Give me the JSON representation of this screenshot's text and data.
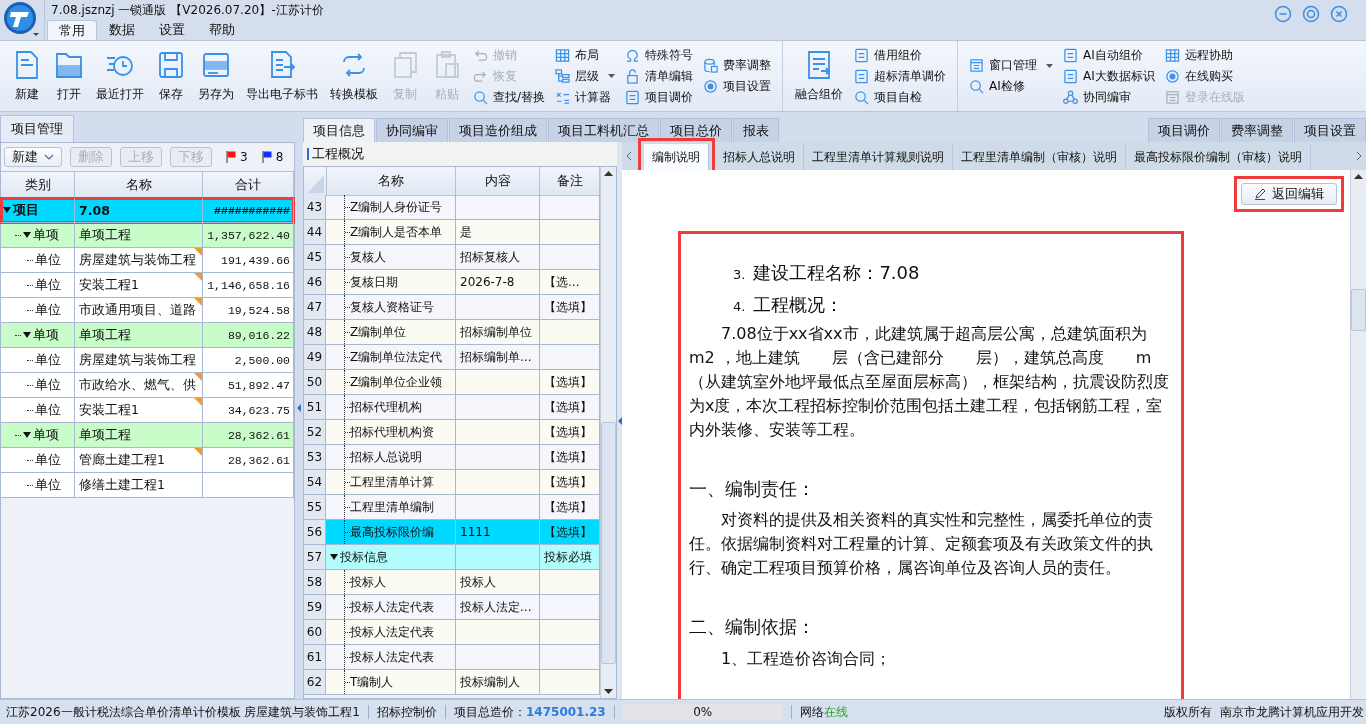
{
  "window": {
    "title": "7.08.jsznzj 一锁通版 【V2026.07.20】-江苏计价"
  },
  "menu_tabs": [
    {
      "label": "常用",
      "selected": true
    },
    {
      "label": "数据",
      "selected": false
    },
    {
      "label": "设置",
      "selected": false
    },
    {
      "label": "帮助",
      "selected": false
    }
  ],
  "toolbar": {
    "sections": [
      {
        "large": [
          {
            "label": "新建",
            "disabled": false
          },
          {
            "label": "打开",
            "disabled": false
          },
          {
            "label": "最近打开",
            "disabled": false
          },
          {
            "label": "保存",
            "disabled": false
          },
          {
            "label": "另存为",
            "disabled": false
          },
          {
            "label": "导出电子标书",
            "disabled": false
          },
          {
            "label": "转换模板",
            "disabled": false
          },
          {
            "label": "复制",
            "disabled": true
          },
          {
            "label": "粘贴",
            "disabled": true
          }
        ],
        "columns": [
          [
            {
              "label": "撤销",
              "disabled": true,
              "dropdown": false
            },
            {
              "label": "恢复",
              "disabled": true,
              "dropdown": false
            },
            {
              "label": "查找/替换",
              "disabled": false,
              "dropdown": false
            }
          ],
          [
            {
              "label": "布局",
              "disabled": false,
              "dropdown": false
            },
            {
              "label": "层级",
              "disabled": false,
              "dropdown": true
            },
            {
              "label": "计算器",
              "disabled": false,
              "dropdown": false
            }
          ],
          [
            {
              "label": "特殊符号",
              "disabled": false,
              "dropdown": false
            },
            {
              "label": "清单编辑",
              "disabled": false,
              "dropdown": false
            },
            {
              "label": "项目调价",
              "disabled": false,
              "dropdown": false
            }
          ],
          [
            {
              "label": "费率调整",
              "disabled": false,
              "dropdown": false
            },
            {
              "label": "项目设置",
              "disabled": false,
              "dropdown": false
            }
          ]
        ]
      },
      {
        "large": [
          {
            "label": "融合组价",
            "disabled": false
          }
        ],
        "columns": [
          [
            {
              "label": "借用组价",
              "disabled": false,
              "dropdown": false
            },
            {
              "label": "超标清单调价",
              "disabled": false,
              "dropdown": false
            },
            {
              "label": "项目自检",
              "disabled": false,
              "dropdown": false
            }
          ]
        ]
      },
      {
        "columns": [
          [
            {
              "label": "窗口管理",
              "disabled": false,
              "dropdown": true
            },
            {
              "label": "AI检修",
              "disabled": false,
              "dropdown": false
            }
          ],
          [
            {
              "label": "AI自动组价",
              "disabled": false,
              "dropdown": false
            },
            {
              "label": "AI大数据标识",
              "disabled": false,
              "dropdown": false
            },
            {
              "label": "协同编审",
              "disabled": false,
              "dropdown": false
            }
          ],
          [
            {
              "label": "远程协助",
              "disabled": false,
              "dropdown": false
            },
            {
              "label": "在线购买",
              "disabled": false,
              "dropdown": false
            },
            {
              "label": "登录在线版",
              "disabled": true,
              "dropdown": false
            }
          ]
        ]
      }
    ]
  },
  "project_panel": {
    "tab": "项目管理",
    "buttons": [
      {
        "label": "新建",
        "disabled": false,
        "dropdown": true
      },
      {
        "label": "删除",
        "disabled": true,
        "dropdown": false
      },
      {
        "label": "上移",
        "disabled": true,
        "dropdown": false
      },
      {
        "label": "下移",
        "disabled": true,
        "dropdown": false
      }
    ],
    "flags": [
      {
        "count": "3",
        "color": "#ff1010"
      },
      {
        "count": "8",
        "color": "#1030ff"
      }
    ],
    "columns": [
      "类别",
      "名称",
      "合计"
    ],
    "tree": [
      {
        "type": "项目",
        "name": "7.08",
        "total": "###########",
        "selected": true,
        "highlighted": true,
        "marked": false,
        "children": [
          {
            "type": "单项",
            "name": "单项工程",
            "total": "1,357,622.40",
            "selected": false,
            "highlighted": false,
            "marked": false,
            "children": [
              {
                "type": "单位",
                "name": "房屋建筑与装饰工程",
                "total": "191,439.66",
                "selected": false,
                "highlighted": false,
                "marked": true
              },
              {
                "type": "单位",
                "name": "安装工程1",
                "total": "1,146,658.16",
                "selected": false,
                "highlighted": false,
                "marked": true
              },
              {
                "type": "单位",
                "name": "市政通用项目、道路",
                "total": "19,524.58",
                "selected": false,
                "highlighted": false,
                "marked": true
              }
            ]
          },
          {
            "type": "单项",
            "name": "单项工程",
            "total": "89,016.22",
            "selected": false,
            "highlighted": false,
            "marked": false,
            "children": [
              {
                "type": "单位",
                "name": "房屋建筑与装饰工程",
                "total": "2,500.00",
                "selected": false,
                "highlighted": false,
                "marked": false
              },
              {
                "type": "单位",
                "name": "市政给水、燃气、供",
                "total": "51,892.47",
                "selected": false,
                "highlighted": false,
                "marked": true
              },
              {
                "type": "单位",
                "name": "安装工程1",
                "total": "34,623.75",
                "selected": false,
                "highlighted": false,
                "marked": true
              }
            ]
          },
          {
            "type": "单项",
            "name": "单项工程",
            "total": "28,362.61",
            "selected": false,
            "highlighted": false,
            "marked": false,
            "children": [
              {
                "type": "单位",
                "name": "管廊土建工程1",
                "total": "28,362.61",
                "selected": false,
                "highlighted": false,
                "marked": true
              },
              {
                "type": "单位",
                "name": "修缮土建工程1",
                "selected": false,
                "highlighted": false,
                "marked": false
              }
            ]
          }
        ]
      }
    ]
  },
  "center_tabs": [
    {
      "label": "项目信息",
      "selected": true
    },
    {
      "label": "协同编审",
      "selected": false
    },
    {
      "label": "项目造价组成",
      "selected": false
    },
    {
      "label": "项目工料机汇总",
      "selected": false
    },
    {
      "label": "项目总价",
      "selected": false
    },
    {
      "label": "报表",
      "selected": false
    }
  ],
  "quick_buttons": [
    "项目调价",
    "费率调整",
    "项目设置"
  ],
  "info": {
    "section_title": "工程概况",
    "columns": [
      "名称",
      "内容",
      "备注"
    ],
    "rows": [
      {
        "kind": "item",
        "number": "43",
        "name": "Z编制人身份证号",
        "selected": false
      },
      {
        "kind": "item",
        "number": "44",
        "name": "Z编制人是否本单",
        "content": "是",
        "selected": false
      },
      {
        "kind": "item",
        "number": "45",
        "name": "复核人",
        "content": "招标复核人",
        "selected": false
      },
      {
        "kind": "item",
        "number": "46",
        "name": "复核日期",
        "content": "2026-7-8",
        "note": "【选...",
        "selected": false
      },
      {
        "kind": "item",
        "number": "47",
        "name": "复核人资格证号",
        "note": "【选填】",
        "selected": false
      },
      {
        "kind": "item",
        "number": "48",
        "name": "Z编制单位",
        "content": "招标编制单位",
        "selected": false
      },
      {
        "kind": "item",
        "number": "49",
        "name": "Z编制单位法定代",
        "content": "招标编制单...",
        "selected": false
      },
      {
        "kind": "item",
        "number": "50",
        "name": "Z编制单位企业领",
        "note": "【选填】",
        "selected": false
      },
      {
        "kind": "item",
        "number": "51",
        "name": "招标代理机构",
        "note": "【选填】",
        "selected": false
      },
      {
        "kind": "item",
        "number": "52",
        "name": "招标代理机构资",
        "note": "【选填】",
        "selected": false
      },
      {
        "kind": "item",
        "number": "53",
        "name": "招标人总说明",
        "note": "【选填】",
        "selected": false
      },
      {
        "kind": "item",
        "number": "54",
        "name": "工程里清单计算",
        "note": "【选填】",
        "selected": false
      },
      {
        "kind": "item",
        "number": "55",
        "name": "工程里清单编制",
        "note": "【选填】",
        "selected": false
      },
      {
        "kind": "item",
        "number": "56",
        "name": "最高投标限价编",
        "content": "1111",
        "note": "【选填】",
        "selected": true
      },
      {
        "kind": "group",
        "number": "57",
        "name": "投标信息",
        "note": "投标必填",
        "selected": false
      },
      {
        "kind": "item",
        "number": "58",
        "name": "投标人",
        "content": "投标人",
        "selected": false
      },
      {
        "kind": "item",
        "number": "59",
        "name": "投标人法定代表",
        "content": "投标人法定...",
        "selected": false
      },
      {
        "kind": "item",
        "number": "60",
        "name": "投标人法定代表",
        "selected": false
      },
      {
        "kind": "item",
        "number": "61",
        "name": "投标人法定代表",
        "selected": false
      },
      {
        "kind": "item",
        "number": "62",
        "name": "T编制人",
        "content": "投标编制人",
        "selected": false
      }
    ]
  },
  "doc_tabs": [
    {
      "label": "编制说明",
      "selected": true,
      "highlighted": true
    },
    {
      "label": "招标人总说明",
      "selected": false,
      "highlighted": false
    },
    {
      "label": "工程里清单计算规则说明",
      "selected": false,
      "highlighted": false
    },
    {
      "label": "工程里清单编制（审核）说明",
      "selected": false,
      "highlighted": false
    },
    {
      "label": "最高投标限价编制（审核）说明",
      "selected": false,
      "highlighted": false
    }
  ],
  "return_button": {
    "label": "返回编辑",
    "highlighted": true
  },
  "document": {
    "highlighted": true,
    "blocks": [
      {
        "kind": "numbered",
        "number": "3.",
        "text": "建设工程名称：7.08"
      },
      {
        "kind": "numbered",
        "number": "4.",
        "text": "工程概况："
      },
      {
        "kind": "paragraph",
        "text": "7.08位于xx省xx市，此建筑属于超高层公寓，总建筑面积为 m2 ，地上建筑　　层（含已建部分　　层），建筑总高度　　m（从建筑室外地坪最低点至屋面层标高），框架结构，抗震设防烈度为x度，本次工程招标控制价范围包括土建工程，包括钢筋工程，室内外装修、安装等工程。"
      },
      {
        "kind": "heading",
        "text": "一、编制责任："
      },
      {
        "kind": "paragraph",
        "text": "对资料的提供及相关资料的真实性和完整性，属委托单位的责任。依据编制资料对工程量的计算、定额套项及有关政策文件的执行、确定工程项目预算价格，属咨询单位及咨询人员的责任。"
      },
      {
        "kind": "heading",
        "text": "二、编制依据："
      },
      {
        "kind": "item",
        "text": "1、工程造价咨询合同；"
      }
    ]
  },
  "status_bar": {
    "template": "江苏2026一般计税法综合单价清单计价模板 房屋建筑与装饰工程1",
    "mode": "招标控制价",
    "total_label": "项目总造价：",
    "total_value": "1475001.23",
    "progress": {
      "level": 0,
      "text": "0%"
    },
    "network_label": "网络",
    "network_status": "在线",
    "copyright": "版权所有",
    "company": "南京市龙腾计算机应用开发"
  }
}
